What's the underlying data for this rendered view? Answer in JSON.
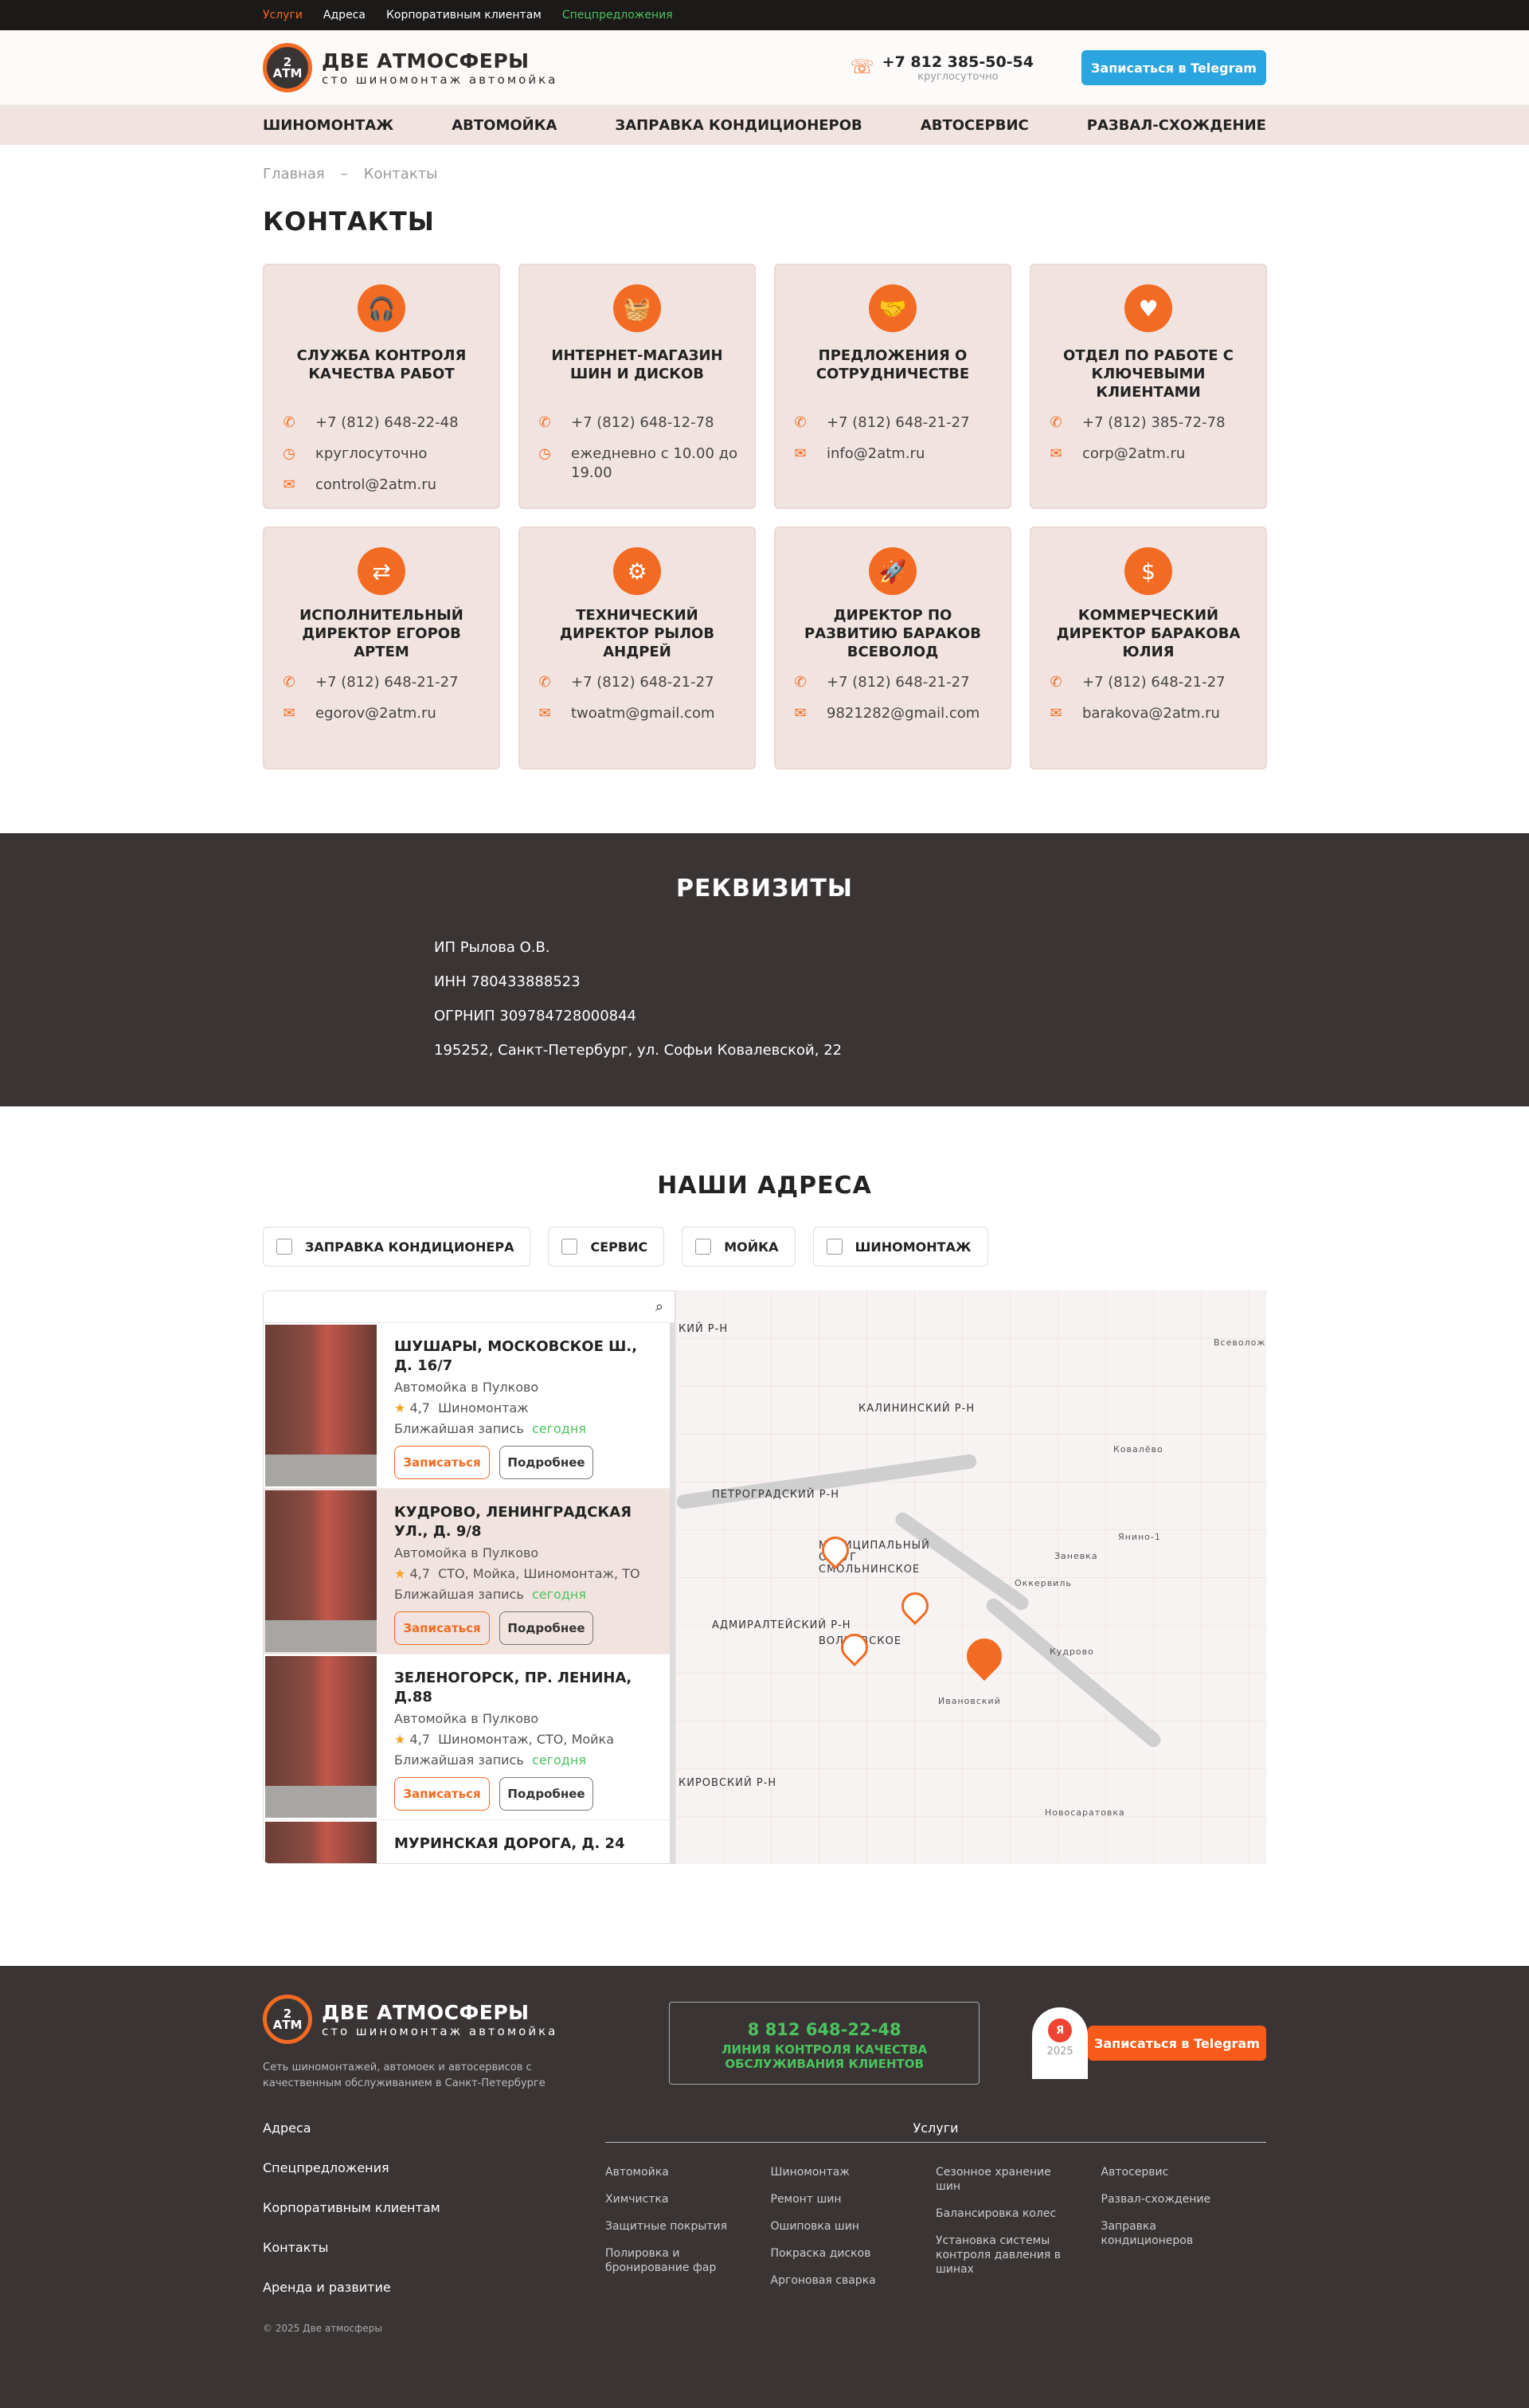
{
  "topbar": {
    "links": [
      "Услуги",
      "Адреса",
      "Корпоративным клиентам",
      "Спецпредложения"
    ]
  },
  "header": {
    "logo_badge_top": "2",
    "logo_badge_bottom": "АТМ",
    "logo_title": "ДВЕ АТМОСФЕРЫ",
    "logo_subtitle": "сто шиномонтаж автомойка",
    "phone": "+7 812 385-50-54",
    "phone_note": "круглосуточно",
    "telegram_button": "Записаться в Telegram"
  },
  "nav": [
    "ШИНОМОНТАЖ",
    "АВТОМОЙКА",
    "ЗАПРАВКА КОНДИЦИОНЕРОВ",
    "АВТОСЕРВИС",
    "РАЗВАЛ-СХОЖДЕНИЕ"
  ],
  "breadcrumbs": {
    "home": "Главная",
    "sep": "–",
    "current": "Контакты"
  },
  "page_title": "КОНТАКТЫ",
  "cards": [
    {
      "title": "СЛУЖБА КОНТРОЛЯ КАЧЕСТВА РАБОТ",
      "phone": "+7 (812) 648-22-48",
      "hours": "круглосуточно",
      "email": "control@2atm.ru"
    },
    {
      "title": "ИНТЕРНЕТ-МАГАЗИН ШИН И ДИСКОВ",
      "phone": "+7 (812) 648-12-78",
      "hours": "ежедневно с 10.00 до 19.00",
      "email": ""
    },
    {
      "title": "ПРЕДЛОЖЕНИЯ О СОТРУДНИЧЕСТВЕ",
      "phone": "+7 (812) 648-21-27",
      "hours": "",
      "email": "info@2atm.ru"
    },
    {
      "title": "ОТДЕЛ ПО РАБОТЕ С КЛЮЧЕВЫМИ КЛИЕНТАМИ",
      "phone": "+7 (812) 385-72-78",
      "hours": "",
      "email": "corp@2atm.ru"
    },
    {
      "title": "ИСПОЛНИТЕЛЬНЫЙ ДИРЕКТОР ЕГОРОВ АРТЕМ",
      "phone": "+7 (812) 648-21-27",
      "hours": "",
      "email": "egorov@2atm.ru"
    },
    {
      "title": "ТЕХНИЧЕСКИЙ ДИРЕКТОР РЫЛОВ АНДРЕЙ",
      "phone": "+7 (812) 648-21-27",
      "hours": "",
      "email": "twoatm@gmail.com"
    },
    {
      "title": "ДИРЕКТОР ПО РАЗВИТИЮ БАРАКОВ ВСЕВОЛОД",
      "phone": "+7 (812) 648-21-27",
      "hours": "",
      "email": "9821282@gmail.com"
    },
    {
      "title": "КОММЕРЧЕСКИЙ ДИРЕКТОР БАРАКОВА ЮЛИЯ",
      "phone": "+7 (812) 648-21-27",
      "hours": "",
      "email": "barakova@2atm.ru"
    }
  ],
  "requisites": {
    "title": "РЕКВИЗИТЫ",
    "lines": [
      "ИП Рылова О.В.",
      "ИНН 780433888523",
      "ОГРНИП 309784728000844",
      "195252, Санкт-Петербург, ул. Софьи Ковалевской, 22"
    ]
  },
  "addresses": {
    "title": "НАШИ АДРЕСА",
    "filters": [
      "ЗАПРАВКА КОНДИЦИОНЕРА",
      "СЕРВИС",
      "МОЙКА",
      "ШИНОМОНТАЖ"
    ],
    "items": [
      {
        "name": "ШУШАРЫ, МОСКОВСКОЕ Ш., Д. 16/7",
        "type": "Автомойка в Пулково",
        "rating": "4,7",
        "services": "Шиномонтаж",
        "next": "Ближайшая запись",
        "when": "сегодня"
      },
      {
        "name": "КУДРОВО, ЛЕНИНГРАДСКАЯ УЛ., Д. 9/8",
        "type": "Автомойка в Пулково",
        "rating": "4,7",
        "services": "СТО, Мойка, Шиномонтаж, ТО",
        "next": "Ближайшая запись",
        "when": "сегодня"
      },
      {
        "name": "ЗЕЛЕНОГОРСК, ПР. ЛЕНИНА, Д.88",
        "type": "Автомойка в Пулково",
        "rating": "4,7",
        "services": "Шиномонтаж, СТО, Мойка",
        "next": "Ближайшая запись",
        "when": "сегодня"
      },
      {
        "name": "МУРИНСКАЯ ДОРОГА, Д. 24",
        "type": "",
        "rating": "",
        "services": "",
        "next": "",
        "when": ""
      }
    ],
    "book_button": "Записаться",
    "details_button": "Подробнее",
    "map_labels": [
      "КИЙ Р-Н",
      "КАЛИНИНСКИЙ Р-Н",
      "ПЕТРОГРАДСКИЙ Р-Н",
      "МУНИЦИПАЛЬНЫЙ ОКРУГ СМОЛЬНИНСКОЕ",
      "АДМИРАЛТЕЙСКИЙ Р-Н",
      "ВОЛКОВСКОЕ",
      "КИРОВСКИЙ Р-Н",
      "Кудрово",
      "Ивановский",
      "Новосаратовка",
      "Заневка",
      "Янино-1",
      "Оккервиль",
      "Всеволожск",
      "Ковалёво"
    ]
  },
  "footer": {
    "description": "Сеть шиномонтажей, автомоек и автосервисов с качественным обслуживанием в Санкт-Петербурге",
    "quality_phone": "8 812 648-22-48",
    "quality_text": "ЛИНИЯ КОНТРОЛЯ КАЧЕСТВА ОБСЛУЖИВАНИЯ КЛИЕНТОВ",
    "badge_letter": "Я",
    "badge_year": "2025",
    "telegram_button": "Записаться в Telegram",
    "links": [
      "Адреса",
      "Спецпредложения",
      "Корпоративным клиентам",
      "Контакты",
      "Аренда и развитие"
    ],
    "services_title": "Услуги",
    "services": [
      [
        "Автомойка",
        "Химчистка",
        "Защитные покрытия",
        "Полировка и бронирование фар"
      ],
      [
        "Шиномонтаж",
        "Ремонт шин",
        "Ошиповка шин",
        "Покраска дисков",
        "Аргоновая сварка"
      ],
      [
        "Сезонное хранение шин",
        "Балансировка колес",
        "Установка системы контроля давления в шинах"
      ],
      [
        "Автосервис",
        "Развал-схождение",
        "Заправка кондиционеров"
      ]
    ],
    "copyright": "© 2025 Две атмосферы"
  },
  "colors": {
    "accent": "#f36b22",
    "telegram": "#2aa5e0",
    "dark": "#3a3434",
    "card_bg": "#f1e4e0"
  }
}
